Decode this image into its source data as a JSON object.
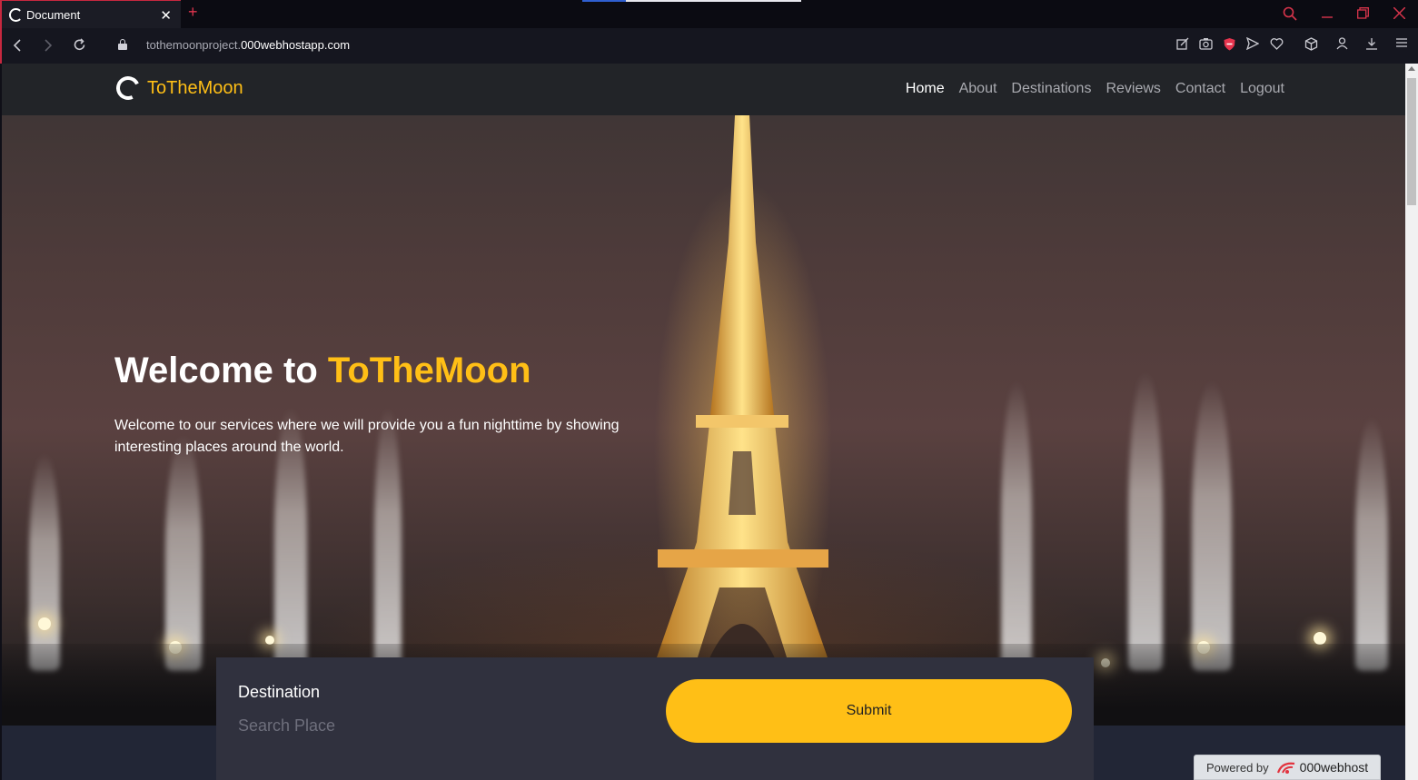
{
  "browser": {
    "tab_title": "Document",
    "tab_close": "✕",
    "new_tab": "+",
    "url_prefix": "tothemoonproject.",
    "url_domain": "000webhostapp.com",
    "accent_color": "#c7283f"
  },
  "navbar": {
    "brand": "ToTheMoon",
    "links": [
      "Home",
      "About",
      "Destinations",
      "Reviews",
      "Contact",
      "Logout"
    ],
    "active_link": "Home"
  },
  "hero": {
    "title_prefix": "Welcome to",
    "title_accent": "ToTheMoon",
    "description": "Welcome to our services where we will provide you a fun nighttime by showing interesting places around the world."
  },
  "search": {
    "label": "Destination",
    "placeholder": "Search Place",
    "value": "",
    "submit_label": "Submit"
  },
  "badge": {
    "prefix": "Powered by",
    "brand": "000webhost"
  },
  "colors": {
    "brand_yellow": "#ffbf16",
    "navbar_bg": "#222428",
    "search_bg": "#30313e"
  }
}
